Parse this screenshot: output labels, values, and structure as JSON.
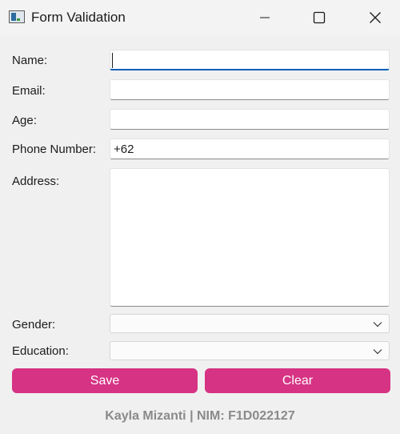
{
  "window": {
    "title": "Form Validation",
    "icon": "app-window-icon",
    "controls": [
      "minimize-icon",
      "maximize-icon",
      "close-icon"
    ]
  },
  "form": {
    "name": {
      "label": "Name:",
      "value": ""
    },
    "email": {
      "label": "Email:",
      "value": ""
    },
    "age": {
      "label": "Age:",
      "value": ""
    },
    "phone": {
      "label": "Phone Number:",
      "value": "+62"
    },
    "address": {
      "label": "Address:",
      "value": ""
    },
    "gender": {
      "label": "Gender:",
      "selected": ""
    },
    "education": {
      "label": "Education:",
      "selected": ""
    }
  },
  "buttons": {
    "save": "Save",
    "clear": "Clear"
  },
  "footer": {
    "text": "Kayla Mizanti | NIM: F1D022127"
  },
  "colors": {
    "accent": "#d63384",
    "focus": "#005fb8",
    "footer_text": "#8a8a8a"
  }
}
